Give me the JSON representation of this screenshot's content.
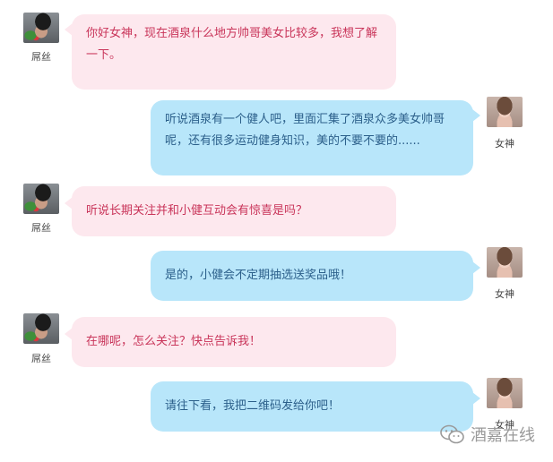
{
  "conversation": {
    "messages": [
      {
        "side": "left",
        "speaker": "屌丝",
        "text": "你好女神，现在酒泉什么地方帅哥美女比较多，我想了解一下。"
      },
      {
        "side": "right",
        "speaker": "女神",
        "text": "听说酒泉有一个健人吧，里面汇集了酒泉众多美女帅哥呢，还有很多运动健身知识，美的不要不要的......"
      },
      {
        "side": "left",
        "speaker": "屌丝",
        "text": "听说长期关注并和小健互动会有惊喜是吗？"
      },
      {
        "side": "right",
        "speaker": "女神",
        "text": "是的，小健会不定期抽选送奖品哦！"
      },
      {
        "side": "left",
        "speaker": "屌丝",
        "text": "在哪呢，怎么关注？快点告诉我！"
      },
      {
        "side": "right",
        "speaker": "女神",
        "text": "请往下看，我把二维码发给你吧！"
      }
    ]
  },
  "watermark": {
    "text": "酒嘉在线",
    "icon": "wechat-icon"
  },
  "colors": {
    "left_bubble_bg": "#fde8ee",
    "left_bubble_text": "#c9355a",
    "right_bubble_bg": "#b8e6fa",
    "right_bubble_text": "#2b5f8a"
  }
}
